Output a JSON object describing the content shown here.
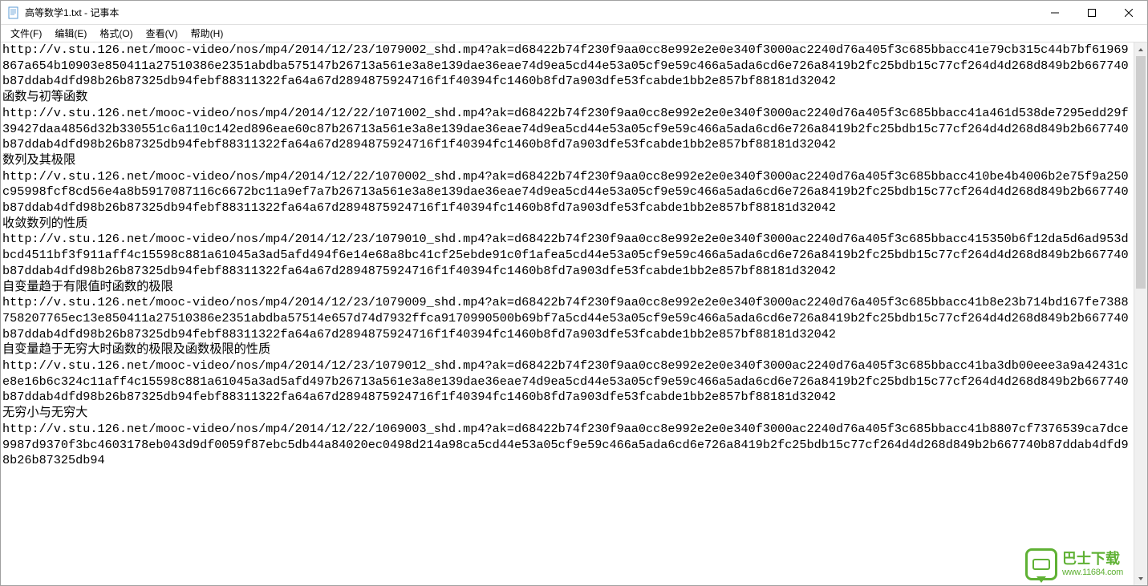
{
  "window": {
    "title": "高等数学1.txt - 记事本"
  },
  "menubar": {
    "file": "文件(F)",
    "edit": "编辑(E)",
    "format": "格式(O)",
    "view": "查看(V)",
    "help": "帮助(H)"
  },
  "content": "http://v.stu.126.net/mooc-video/nos/mp4/2014/12/23/1079002_shd.mp4?ak=d68422b74f230f9aa0cc8e992e2e0e340f3000ac2240d76a405f3c685bbacc41e79cb315c44b7bf61969867a654b10903e850411a27510386e2351abdba575147b26713a561e3a8e139dae36eae74d9ea5cd44e53a05cf9e59c466a5ada6cd6e726a8419b2fc25bdb15c77cf264d4d268d849b2b667740b87ddab4dfd98b26b87325db94febf88311322fa64a67d2894875924716f1f40394fc1460b8fd7a903dfe53fcabde1bb2e857bf88181d32042\n函数与初等函数\nhttp://v.stu.126.net/mooc-video/nos/mp4/2014/12/22/1071002_shd.mp4?ak=d68422b74f230f9aa0cc8e992e2e0e340f3000ac2240d76a405f3c685bbacc41a461d538de7295edd29f39427daa4856d32b330551c6a110c142ed896eae60c87b26713a561e3a8e139dae36eae74d9ea5cd44e53a05cf9e59c466a5ada6cd6e726a8419b2fc25bdb15c77cf264d4d268d849b2b667740b87ddab4dfd98b26b87325db94febf88311322fa64a67d2894875924716f1f40394fc1460b8fd7a903dfe53fcabde1bb2e857bf88181d32042\n数列及其极限\nhttp://v.stu.126.net/mooc-video/nos/mp4/2014/12/22/1070002_shd.mp4?ak=d68422b74f230f9aa0cc8e992e2e0e340f3000ac2240d76a405f3c685bbacc410be4b4006b2e75f9a250c95998fcf8cd56e4a8b5917087116c6672bc11a9ef7a7b26713a561e3a8e139dae36eae74d9ea5cd44e53a05cf9e59c466a5ada6cd6e726a8419b2fc25bdb15c77cf264d4d268d849b2b667740b87ddab4dfd98b26b87325db94febf88311322fa64a67d2894875924716f1f40394fc1460b8fd7a903dfe53fcabde1bb2e857bf88181d32042\n收敛数列的性质\nhttp://v.stu.126.net/mooc-video/nos/mp4/2014/12/23/1079010_shd.mp4?ak=d68422b74f230f9aa0cc8e992e2e0e340f3000ac2240d76a405f3c685bbacc415350b6f12da5d6ad953dbcd4511bf3f911aff4c15598c881a61045a3ad5afd494f6e14e68a8bc41cf25ebde91c0f1afea5cd44e53a05cf9e59c466a5ada6cd6e726a8419b2fc25bdb15c77cf264d4d268d849b2b667740b87ddab4dfd98b26b87325db94febf88311322fa64a67d2894875924716f1f40394fc1460b8fd7a903dfe53fcabde1bb2e857bf88181d32042\n自变量趋于有限值时函数的极限\nhttp://v.stu.126.net/mooc-video/nos/mp4/2014/12/23/1079009_shd.mp4?ak=d68422b74f230f9aa0cc8e992e2e0e340f3000ac2240d76a405f3c685bbacc41b8e23b714bd167fe7388758207765ec13e850411a27510386e2351abdba57514e657d74d7932ffca9170990500b69bf7a5cd44e53a05cf9e59c466a5ada6cd6e726a8419b2fc25bdb15c77cf264d4d268d849b2b667740b87ddab4dfd98b26b87325db94febf88311322fa64a67d2894875924716f1f40394fc1460b8fd7a903dfe53fcabde1bb2e857bf88181d32042\n自变量趋于无穷大时函数的极限及函数极限的性质\nhttp://v.stu.126.net/mooc-video/nos/mp4/2014/12/23/1079012_shd.mp4?ak=d68422b74f230f9aa0cc8e992e2e0e340f3000ac2240d76a405f3c685bbacc41ba3db00eee3a9a42431ce8e16b6c324c11aff4c15598c881a61045a3ad5afd497b26713a561e3a8e139dae36eae74d9ea5cd44e53a05cf9e59c466a5ada6cd6e726a8419b2fc25bdb15c77cf264d4d268d849b2b667740b87ddab4dfd98b26b87325db94febf88311322fa64a67d2894875924716f1f40394fc1460b8fd7a903dfe53fcabde1bb2e857bf88181d32042\n无穷小与无穷大\nhttp://v.stu.126.net/mooc-video/nos/mp4/2014/12/22/1069003_shd.mp4?ak=d68422b74f230f9aa0cc8e992e2e0e340f3000ac2240d76a405f3c685bbacc41b8807cf7376539ca7dce9987d9370f3bc4603178eb043d9df0059f87ebc5db44a84020ec0498d214a98ca5cd44e53a05cf9e59c466a5ada6cd6e726a8419b2fc25bdb15c77cf264d4d268d849b2b667740b87ddab4dfd98b26b87325db94",
  "watermark": {
    "cn": "巴士下载",
    "url": "www.11684.com"
  }
}
